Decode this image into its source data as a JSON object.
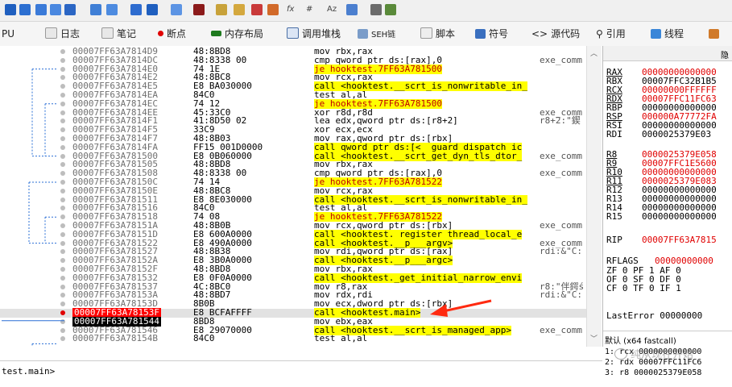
{
  "tabs": [
    {
      "label": "PU"
    },
    {
      "label": "日志"
    },
    {
      "label": "笔记"
    },
    {
      "label": "断点"
    },
    {
      "label": "内存布局"
    },
    {
      "label": "调用堆栈"
    },
    {
      "label": "SEH链"
    },
    {
      "label": "脚本"
    },
    {
      "label": "符号"
    },
    {
      "label": "源代码"
    },
    {
      "label": "引用"
    },
    {
      "label": "线程"
    }
  ],
  "toolbar": {
    "fx_label": "fx",
    "hash_label": "#",
    "az_label": "Az"
  },
  "rows": [
    {
      "addr": "00007FF63A7814D9",
      "bytes": "48:8BD8",
      "instr": "mov rbx,rax",
      "cmt": ""
    },
    {
      "addr": "00007FF63A7814DC",
      "bytes": "48:8338 00",
      "instr": "cmp qword ptr ds:[rax],0",
      "cmt": "exe_comm"
    },
    {
      "addr": "00007FF63A7814E0",
      "bytes": "74 1E",
      "instr": "je hooktest.7FF63A781500",
      "cmt": ""
    },
    {
      "addr": "00007FF63A7814E2",
      "bytes": "48:8BC8",
      "instr": "mov rcx,rax",
      "cmt": ""
    },
    {
      "addr": "00007FF63A7814E5",
      "bytes": "E8 BA030000",
      "instr": "call <hooktest.__scrt_is_nonwritable_in_",
      "cmt": ""
    },
    {
      "addr": "00007FF63A7814EA",
      "bytes": "84C0",
      "instr": "test al,al",
      "cmt": ""
    },
    {
      "addr": "00007FF63A7814EC",
      "bytes": "74 12",
      "instr": "je hooktest.7FF63A781500",
      "cmt": ""
    },
    {
      "addr": "00007FF63A7814EE",
      "bytes": "45:33C0",
      "instr": "xor r8d,r8d",
      "cmt": "exe_comm"
    },
    {
      "addr": "00007FF63A7814F1",
      "bytes": "41:8D50 02",
      "instr": "lea edx,qword ptr ds:[r8+2]",
      "cmt": "r8+2:\"鍥"
    },
    {
      "addr": "00007FF63A7814F5",
      "bytes": "33C9",
      "instr": "xor ecx,ecx",
      "cmt": ""
    },
    {
      "addr": "00007FF63A7814F7",
      "bytes": "48:8B03",
      "instr": "mov rax,qword ptr ds:[rbx]",
      "cmt": ""
    },
    {
      "addr": "00007FF63A7814FA",
      "bytes": "FF15 001D0000",
      "instr": "call qword ptr ds:[<__guard_dispatch_ic",
      "cmt": ""
    },
    {
      "addr": "00007FF63A781500",
      "bytes": "E8 0B060000",
      "instr": "call <hooktest.__scrt_get_dyn_tls_dtor_",
      "cmt": "exe_comm"
    },
    {
      "addr": "00007FF63A781505",
      "bytes": "48:8BD8",
      "instr": "mov rbx,rax",
      "cmt": ""
    },
    {
      "addr": "00007FF63A781508",
      "bytes": "48:8338 00",
      "instr": "cmp qword ptr ds:[rax],0",
      "cmt": "exe_comm"
    },
    {
      "addr": "00007FF63A78150C",
      "bytes": "74 14",
      "instr": "je hooktest.7FF63A781522",
      "cmt": ""
    },
    {
      "addr": "00007FF63A78150E",
      "bytes": "48:8BC8",
      "instr": "mov rcx,rax",
      "cmt": ""
    },
    {
      "addr": "00007FF63A781511",
      "bytes": "E8 8E030000",
      "instr": "call <hooktest.__scrt_is_nonwritable_in_",
      "cmt": ""
    },
    {
      "addr": "00007FF63A781516",
      "bytes": "84C0",
      "instr": "test al,al",
      "cmt": ""
    },
    {
      "addr": "00007FF63A781518",
      "bytes": "74 08",
      "instr": "je hooktest.7FF63A781522",
      "cmt": ""
    },
    {
      "addr": "00007FF63A78151A",
      "bytes": "48:8B0B",
      "instr": "mov rcx,qword ptr ds:[rbx]",
      "cmt": "exe_comm"
    },
    {
      "addr": "00007FF63A78151D",
      "bytes": "E8 600A0000",
      "instr": "call <hooktest._register_thread_local_e",
      "cmt": ""
    },
    {
      "addr": "00007FF63A781522",
      "bytes": "E8 490A0000",
      "instr": "call <hooktest.__p___argv>",
      "cmt": "exe_comm"
    },
    {
      "addr": "00007FF63A781527",
      "bytes": "48:8B38",
      "instr": "mov rdi,qword ptr ds:[rax]",
      "cmt": "rdi:&\"C:"
    },
    {
      "addr": "00007FF63A78152A",
      "bytes": "E8 3B0A0000",
      "instr": "call <hooktest.__p___argc>",
      "cmt": ""
    },
    {
      "addr": "00007FF63A78152F",
      "bytes": "48:8BD8",
      "instr": "mov rbx,rax",
      "cmt": ""
    },
    {
      "addr": "00007FF63A781532",
      "bytes": "E8 0F0A0000",
      "instr": "call <hooktest._get_initial_narrow_envi",
      "cmt": ""
    },
    {
      "addr": "00007FF63A781537",
      "bytes": "4C:8BC0",
      "instr": "mov r8,rax",
      "cmt": "r8:\"伴鍔ś"
    },
    {
      "addr": "00007FF63A78153A",
      "bytes": "48:8BD7",
      "instr": "mov rdx,rdi",
      "cmt": "rdi:&\"C:"
    },
    {
      "addr": "00007FF63A78153D",
      "bytes": "8B0B",
      "instr": "mov ecx,dword ptr ds:[rbx]",
      "cmt": ""
    },
    {
      "addr": "00007FF63A78153F",
      "bytes": "E8 BCFAFFFF",
      "instr": "call <hooktest.main>",
      "cmt": ""
    },
    {
      "addr": "00007FF63A781544",
      "bytes": "8BD8",
      "instr": "mov ebx,eax",
      "cmt": ""
    },
    {
      "addr": "00007FF63A781546",
      "bytes": "E8 29070000",
      "instr": "call <hooktest.__scrt_is_managed_app>",
      "cmt": "exe_comm"
    },
    {
      "addr": "00007FF63A78154B",
      "bytes": "84C0",
      "instr": "test al,al",
      "cmt": ""
    }
  ],
  "registers_header": "隐",
  "registers": [
    {
      "name": "RAX",
      "value": "00000000000000"
    },
    {
      "name": "RBX",
      "value": "00007FFC32B1B5"
    },
    {
      "name": "RCX",
      "value": "00000000FFFFFF"
    },
    {
      "name": "RDX",
      "value": "00007FFC11FC63"
    },
    {
      "name": "RBP",
      "value": "00000000000000"
    },
    {
      "name": "RSP",
      "value": "000000A77772FA"
    },
    {
      "name": "RSI",
      "value": "00000000000000"
    },
    {
      "name": "RDI",
      "value": "0000025379E03"
    },
    {
      "name": "R8",
      "value": "0000025379E058"
    },
    {
      "name": "R9",
      "value": "00007FFC1E5600"
    },
    {
      "name": "R10",
      "value": "00000000000000"
    },
    {
      "name": "R11",
      "value": "0000025379E083"
    },
    {
      "name": "R12",
      "value": "00000000000000"
    },
    {
      "name": "R13",
      "value": "00000000000000"
    },
    {
      "name": "R14",
      "value": "00000000000000"
    },
    {
      "name": "R15",
      "value": "00000000000000"
    },
    {
      "name": "RIP",
      "value": "00007FF63A7815"
    },
    {
      "name": "RFLAGS",
      "value": "00000000000"
    }
  ],
  "flags": [
    "ZF 0  PF 1  AF 0",
    "OF 0  SF 0  DF 0",
    "CF 0  TF 0  IF 1"
  ],
  "last_error": "LastError  00000000",
  "callconv": "默认 (x64 fastcall)",
  "call_args": [
    "1: rcx 0000000000000",
    "2: rdx 00007FFC11FC6",
    "3: r8 0000025379E058"
  ],
  "status_text": "test.main>",
  "watermark": "纯从现在开始"
}
